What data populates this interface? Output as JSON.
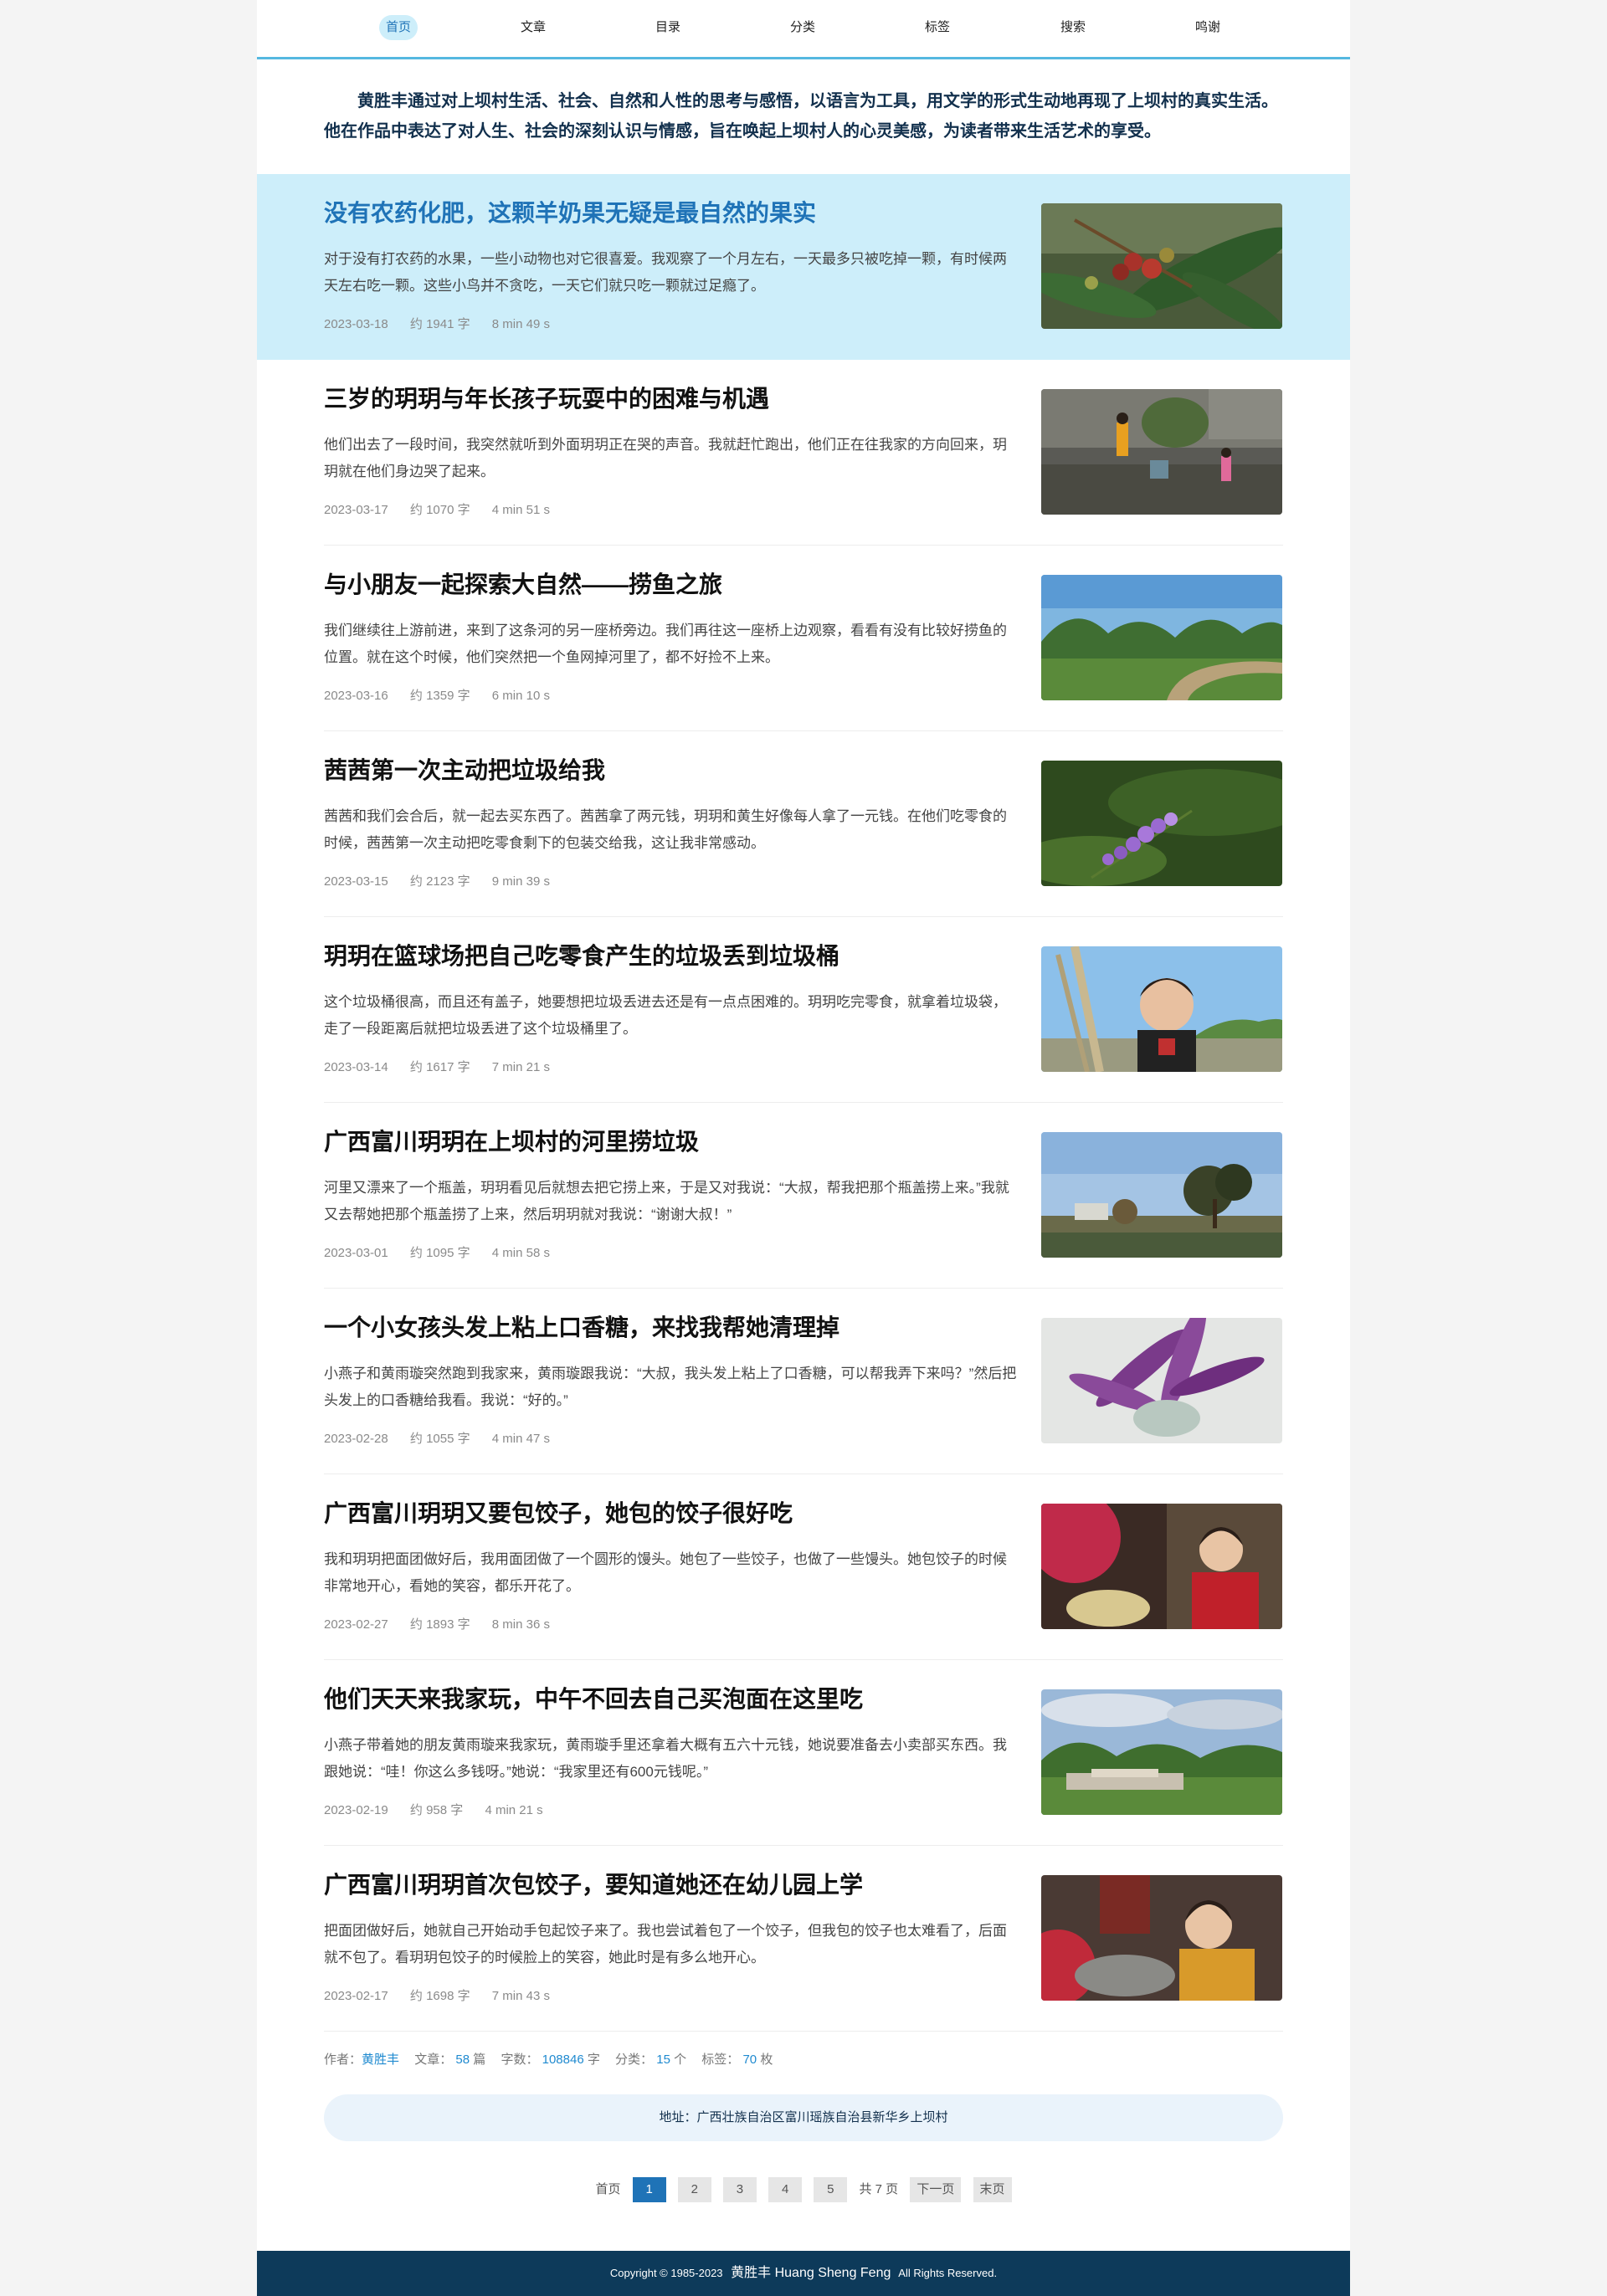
{
  "nav": {
    "items": [
      {
        "label": "首页",
        "active": true
      },
      {
        "label": "文章"
      },
      {
        "label": "目录"
      },
      {
        "label": "分类"
      },
      {
        "label": "标签"
      },
      {
        "label": "搜索"
      },
      {
        "label": "鸣谢"
      }
    ]
  },
  "intro": "黄胜丰通过对上坝村生活、社会、自然和人性的思考与感悟，以语言为工具，用文学的形式生动地再现了上坝村的真实生活。他在作品中表达了对人生、社会的深刻认识与情感，旨在唤起上坝村人的心灵美感，为读者带来生活艺术的享受。",
  "articles": [
    {
      "title": "没有农药化肥，这颗羊奶果无疑是最自然的果实",
      "excerpt": "对于没有打农药的水果，一些小动物也对它很喜爱。我观察了一个月左右，一天最多只被吃掉一颗，有时候两天左右吃一颗。这些小鸟并不贪吃，一天它们就只吃一颗就过足瘾了。",
      "date": "2023-03-18",
      "words": "约 1941 字",
      "time": "8 min 49 s",
      "image": "berries-photo"
    },
    {
      "title": "三岁的玥玥与年长孩子玩耍中的困难与机遇",
      "excerpt": "他们出去了一段时间，我突然就听到外面玥玥正在哭的声音。我就赶忙跑出，他们正在往我家的方向回来，玥玥就在他们身边哭了起来。",
      "date": "2023-03-17",
      "words": "约 1070 字",
      "time": "4 min 51 s",
      "image": "village-children-photo"
    },
    {
      "title": "与小朋友一起探索大自然——捞鱼之旅",
      "excerpt": "我们继续往上游前进，来到了这条河的另一座桥旁边。我们再往这一座桥上边观察，看看有没有比较好捞鱼的位置。就在这个时候，他们突然把一个鱼网掉河里了，都不好捡不上来。",
      "date": "2023-03-16",
      "words": "约 1359 字",
      "time": "6 min 10 s",
      "image": "hills-road-photo"
    },
    {
      "title": "茜茜第一次主动把垃圾给我",
      "excerpt": "茜茜和我们会合后，就一起去买东西了。茜茜拿了两元钱，玥玥和黄生好像每人拿了一元钱。在他们吃零食的时候，茜茜第一次主动把吃零食剩下的包装交给我，这让我非常感动。",
      "date": "2023-03-15",
      "words": "约 2123 字",
      "time": "9 min 39 s",
      "image": "purple-flower-photo"
    },
    {
      "title": "玥玥在篮球场把自己吃零食产生的垃圾丢到垃圾桶",
      "excerpt": "这个垃圾桶很高，而且还有盖子，她要想把垃圾丢进去还是有一点点困难的。玥玥吃完零食，就拿着垃圾袋，走了一段距离后就把垃圾丢进了这个垃圾桶里了。",
      "date": "2023-03-14",
      "words": "约 1617 字",
      "time": "7 min 21 s",
      "image": "girl-reeds-photo"
    },
    {
      "title": "广西富川玥玥在上坝村的河里捞垃圾",
      "excerpt": "河里又漂来了一个瓶盖，玥玥看见后就想去把它捞上来，于是又对我说：“大叔，帮我把那个瓶盖捞上来。”我就又去帮她把那个瓶盖捞了上来，然后玥玥就对我说：“谢谢大叔！”",
      "date": "2023-03-01",
      "words": "约 1095 字",
      "time": "4 min 58 s",
      "image": "riverside-trees-photo"
    },
    {
      "title": "一个小女孩头发上粘上口香糖，来找我帮她清理掉",
      "excerpt": "小燕子和黄雨璇突然跑到我家来，黄雨璇跟我说：“大叔，我头发上粘上了口香糖，可以帮我弄下来吗？”然后把头发上的口香糖给我看。我说：“好的。”",
      "date": "2023-02-28",
      "words": "约 1055 字",
      "time": "4 min 47 s",
      "image": "purple-plant-photo"
    },
    {
      "title": "广西富川玥玥又要包饺子，她包的饺子很好吃",
      "excerpt": "我和玥玥把面团做好后，我用面团做了一个圆形的馒头。她包了一些饺子，也做了一些馒头。她包饺子的时候非常地开心，看她的笑容，都乐开花了。",
      "date": "2023-02-27",
      "words": "约 1893 字",
      "time": "8 min 36 s",
      "image": "dumplings-girl-photo"
    },
    {
      "title": "他们天天来我家玩，中午不回去自己买泡面在这里吃",
      "excerpt": "小燕子带着她的朋友黄雨璇来我家玩，黄雨璇手里还拿着大概有五六十元钱，她说要准备去小卖部买东西。我跟她说：“哇！你这么多钱呀。”她说：“我家里还有600元钱呢。”",
      "date": "2023-02-19",
      "words": "约 958 字",
      "time": "4 min 21 s",
      "image": "village-valley-photo"
    },
    {
      "title": "广西富川玥玥首次包饺子，要知道她还在幼儿园上学",
      "excerpt": "把面团做好后，她就自己开始动手包起饺子来了。我也尝试着包了一个饺子，但我包的饺子也太难看了，后面就不包了。看玥玥包饺子的时候脸上的笑容，她此时是有多么地开心。",
      "date": "2023-02-17",
      "words": "约 1698 字",
      "time": "7 min 43 s",
      "image": "girl-making-dumplings-photo"
    }
  ],
  "stats": {
    "author_label": "作者：",
    "author": "黄胜丰",
    "articles_label": "文章：",
    "articles": "58",
    "articles_unit": "篇",
    "words_label": "字数：",
    "words": "108846",
    "words_unit": "字",
    "categories_label": "分类：",
    "categories": "15",
    "categories_unit": "个",
    "tags_label": "标签：",
    "tags": "70",
    "tags_unit": "枚"
  },
  "address": "地址：广西壮族自治区富川瑶族自治县新华乡上坝村",
  "pagination": {
    "first": "首页",
    "pages": [
      "1",
      "2",
      "3",
      "4",
      "5"
    ],
    "current": "1",
    "total": "共 7 页",
    "next": "下一页",
    "last": "末页"
  },
  "footer": {
    "copyright": "Copyright © 1985-2023",
    "name": "黄胜丰 Huang Sheng Feng",
    "rights": "All Rights Reserved."
  },
  "colors": {
    "accent": "#1f73b7",
    "highlight_bg": "#cdeefa",
    "footer_bg": "#0d3a5a",
    "nav_border": "#55b8e0"
  }
}
